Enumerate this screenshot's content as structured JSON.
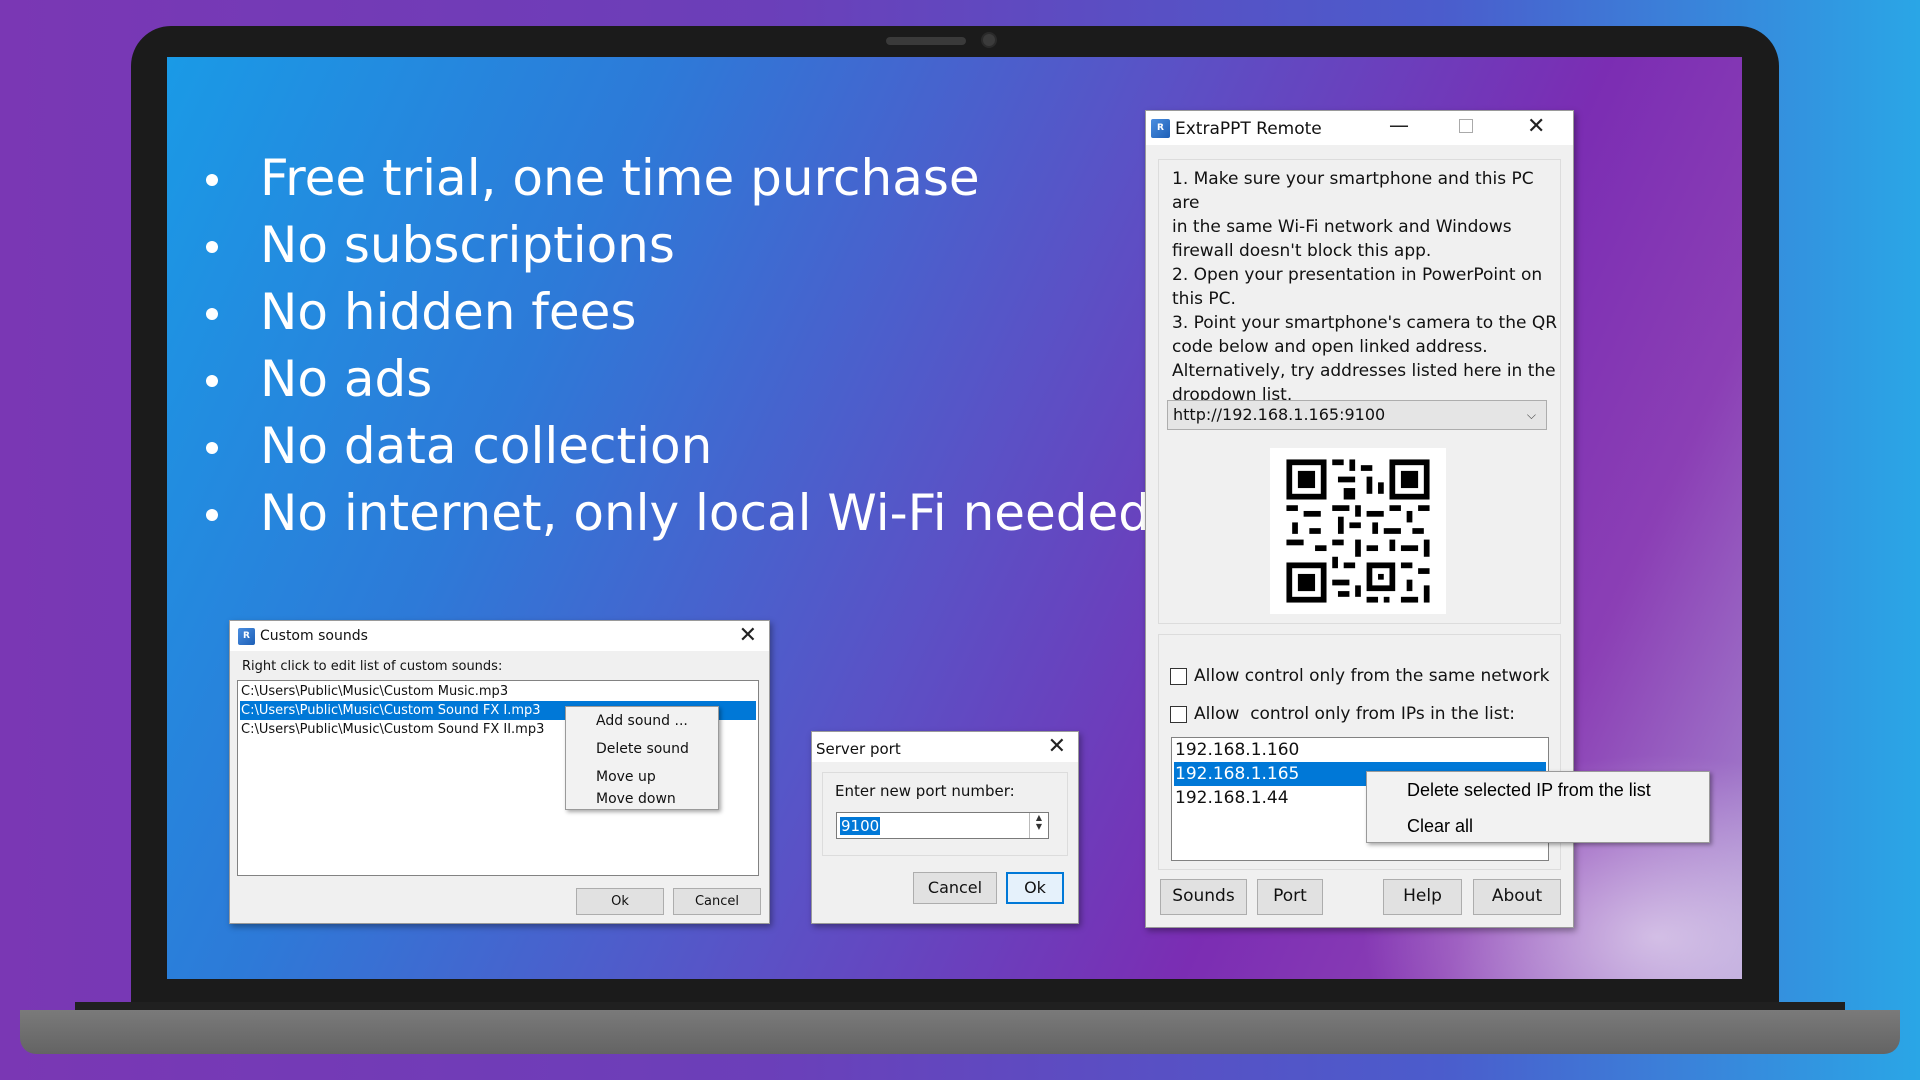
{
  "slide": {
    "bullets": [
      "Free trial, one time purchase",
      "No subscriptions",
      "No hidden fees",
      "No ads",
      "No data collection",
      "No internet, only local Wi-Fi needed"
    ]
  },
  "custom_sounds": {
    "title": "Custom sounds",
    "instruction": "Right click to edit list of custom sounds:",
    "items": [
      "C:\\Users\\Public\\Music\\Custom Music.mp3",
      "C:\\Users\\Public\\Music\\Custom Sound FX I.mp3",
      "C:\\Users\\Public\\Music\\Custom Sound FX II.mp3"
    ],
    "selected_index": 1,
    "context_menu": [
      "Add sound ...",
      "Delete sound",
      "Move up",
      "Move down"
    ],
    "ok_label": "Ok",
    "cancel_label": "Cancel"
  },
  "server_port": {
    "title": "Server port",
    "prompt": "Enter new port number:",
    "value": "9100",
    "cancel_label": "Cancel",
    "ok_label": "Ok"
  },
  "remote": {
    "title": "ExtraPPT Remote",
    "instructions": [
      "1. Make sure your smartphone and this PC are",
      "in the same Wi-Fi network and Windows",
      "firewall doesn't block this app.",
      "2. Open your presentation in PowerPoint on",
      "this PC.",
      "3. Point your smartphone's camera to the QR",
      "code below and open linked address.",
      "Alternatively, try addresses listed here in the",
      "dropdown list."
    ],
    "address": "http://192.168.1.165:9100",
    "allow_same_network_label": "Allow control only from the same network",
    "allow_same_network_checked": false,
    "allow_ip_list_label": "Allow  control only from IPs in the list:",
    "allow_ip_list_checked": false,
    "ip_list": [
      "192.168.1.160",
      "192.168.1.165",
      "192.168.1.44"
    ],
    "selected_ip_index": 1,
    "ip_context_menu": [
      "Delete selected IP from the list",
      "Clear all"
    ],
    "buttons": {
      "sounds": "Sounds",
      "port": "Port",
      "help": "Help",
      "about": "About"
    }
  },
  "colors": {
    "selection": "#0078d7",
    "window_bg": "#f0f0f0"
  }
}
